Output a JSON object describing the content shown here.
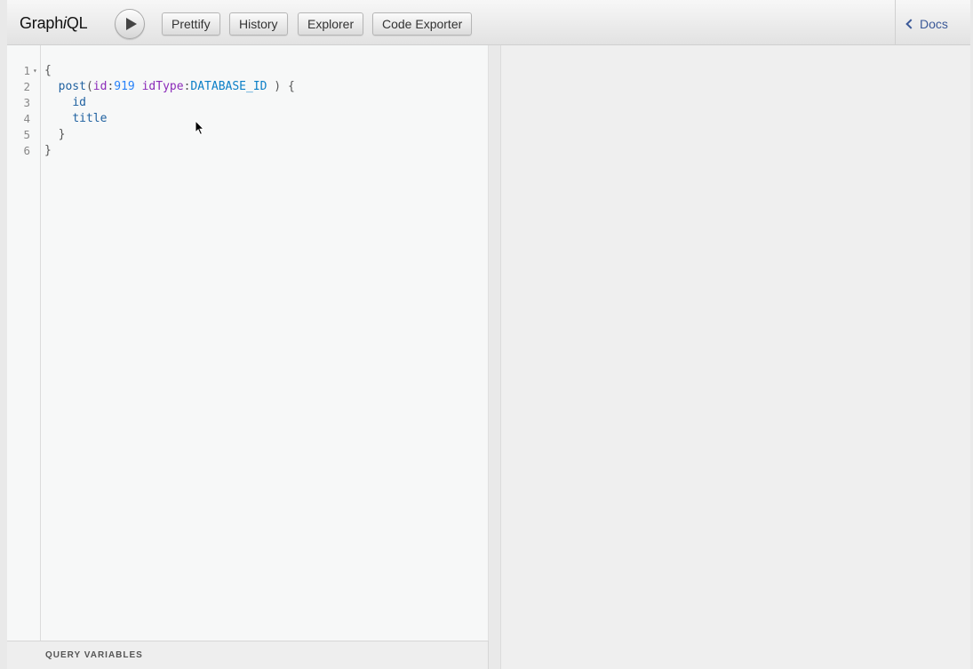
{
  "app": {
    "logo_prefix": "Graph",
    "logo_italic": "i",
    "logo_suffix": "QL"
  },
  "toolbar": {
    "run_icon": "play-icon",
    "buttons": [
      "Prettify",
      "History",
      "Explorer",
      "Code Exporter"
    ]
  },
  "docs": {
    "label": "Docs",
    "icon": "chevron-left-icon"
  },
  "editor": {
    "line_numbers": [
      "1",
      "2",
      "3",
      "4",
      "5",
      "6"
    ],
    "lines": [
      {
        "indent": "",
        "tokens": [
          {
            "text": "{",
            "kind": "punct"
          }
        ]
      },
      {
        "indent": "  ",
        "tokens": [
          {
            "text": "post",
            "kind": "field"
          },
          {
            "text": "(",
            "kind": "punct"
          },
          {
            "text": "id",
            "kind": "arg"
          },
          {
            "text": ":",
            "kind": "punct"
          },
          {
            "text": "919",
            "kind": "num"
          },
          {
            "text": " ",
            "kind": "punct"
          },
          {
            "text": "idType",
            "kind": "arg"
          },
          {
            "text": ":",
            "kind": "punct"
          },
          {
            "text": "DATABASE_ID",
            "kind": "enum"
          },
          {
            "text": " ) {",
            "kind": "punct"
          }
        ]
      },
      {
        "indent": "    ",
        "tokens": [
          {
            "text": "id",
            "kind": "field"
          }
        ]
      },
      {
        "indent": "    ",
        "tokens": [
          {
            "text": "title",
            "kind": "field"
          }
        ]
      },
      {
        "indent": "  ",
        "tokens": [
          {
            "text": "}",
            "kind": "punct"
          }
        ]
      },
      {
        "indent": "",
        "tokens": [
          {
            "text": "}",
            "kind": "punct"
          }
        ]
      }
    ]
  },
  "variables": {
    "title": "QUERY VARIABLES"
  }
}
